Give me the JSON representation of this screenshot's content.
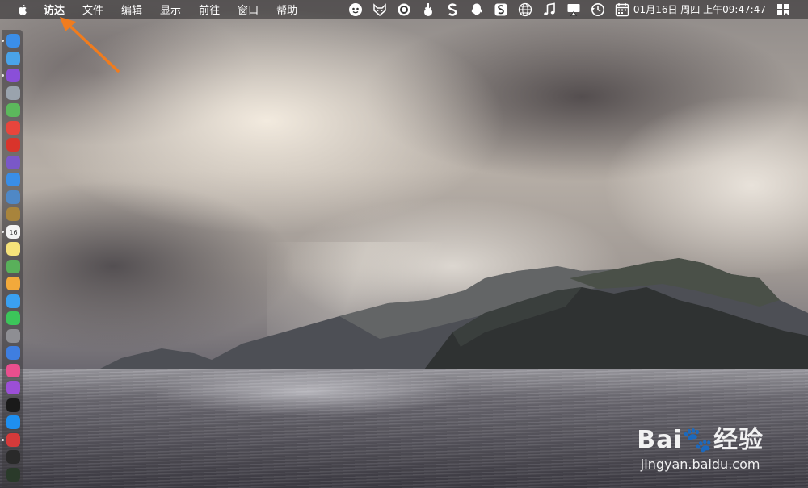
{
  "menubar": {
    "apple_icon": "apple-icon",
    "items": [
      "访达",
      "文件",
      "编辑",
      "显示",
      "前往",
      "窗口",
      "帮助"
    ],
    "active_item": "访达",
    "status_icons": [
      "baidu-netdisk-icon",
      "fox-icon",
      "ring-icon",
      "download-icon",
      "s-icon",
      "qq-icon",
      "sogou-input-icon",
      "globe-icon",
      "music-note-icon",
      "airplay-icon",
      "time-machine-icon",
      "calendar-icon"
    ],
    "clock": "01月16日 周四 上午09:47:47",
    "right_icon": "app-grid-icon"
  },
  "dock": {
    "apps": [
      {
        "name": "finder",
        "color": "#3b8ee8"
      },
      {
        "name": "safari",
        "color": "#4aa3e8"
      },
      {
        "name": "siri",
        "color": "#8a4fd8"
      },
      {
        "name": "launchpad",
        "color": "#9aa3ad"
      },
      {
        "name": "android-studio",
        "color": "#5cb85c"
      },
      {
        "name": "chrome",
        "color": "#e8453c"
      },
      {
        "name": "app-red",
        "color": "#d9342b"
      },
      {
        "name": "app-purple",
        "color": "#7a58c8"
      },
      {
        "name": "safari-compass",
        "color": "#3a8ee6"
      },
      {
        "name": "preview",
        "color": "#4f88c6"
      },
      {
        "name": "notes-brown",
        "color": "#a8843c"
      },
      {
        "name": "calendar",
        "color": "#f4f4f4"
      },
      {
        "name": "notes",
        "color": "#f5e27a"
      },
      {
        "name": "maps",
        "color": "#59b05a"
      },
      {
        "name": "photos",
        "color": "#f2a93b"
      },
      {
        "name": "messages",
        "color": "#3aa0f0"
      },
      {
        "name": "facetime",
        "color": "#3cc55a"
      },
      {
        "name": "system-preferences",
        "color": "#8e8e93"
      },
      {
        "name": "keynote",
        "color": "#3f7ee0"
      },
      {
        "name": "itunes",
        "color": "#e94f8e"
      },
      {
        "name": "podcasts",
        "color": "#9b4fd6"
      },
      {
        "name": "apple-tv",
        "color": "#1a1a1a"
      },
      {
        "name": "app-store",
        "color": "#1e8ff0"
      },
      {
        "name": "vivaldi",
        "color": "#d53a3a"
      },
      {
        "name": "terminal",
        "color": "#2a2a2a"
      },
      {
        "name": "activity-monitor",
        "color": "#2a3a2a"
      }
    ],
    "calendar_day": "16"
  },
  "watermark": {
    "logo": "Bai🐾经验",
    "url": "jingyan.baidu.com"
  },
  "annotation_color": "#f07c1e"
}
